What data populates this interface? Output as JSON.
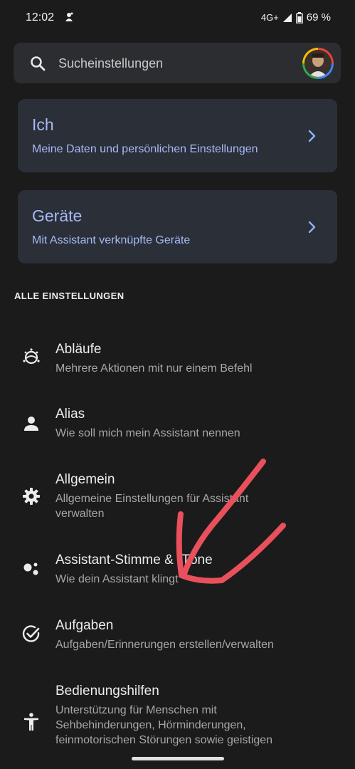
{
  "status_bar": {
    "time": "12:02",
    "network": "4G+",
    "battery": "69 %"
  },
  "search": {
    "placeholder": "Sucheinstellungen"
  },
  "cards": [
    {
      "title": "Ich",
      "subtitle": "Meine Daten und persönlichen Einstellungen"
    },
    {
      "title": "Geräte",
      "subtitle": "Mit Assistant verknüpfte Geräte"
    }
  ],
  "section_header": "ALLE EINSTELLUNGEN",
  "settings": [
    {
      "title": "Abläufe",
      "subtitle": "Mehrere Aktionen mit nur einem Befehl",
      "icon": "routines-icon"
    },
    {
      "title": "Alias",
      "subtitle": "Wie soll mich mein Assistant nennen",
      "icon": "person-icon"
    },
    {
      "title": "Allgemein",
      "subtitle": "Allgemeine Einstellungen für Assistant verwalten",
      "icon": "gear-icon"
    },
    {
      "title": "Assistant-Stimme & -Töne",
      "subtitle": "Wie dein Assistant klingt",
      "icon": "assistant-icon"
    },
    {
      "title": "Aufgaben",
      "subtitle": "Aufgaben/Erinnerungen erstellen/verwalten",
      "icon": "check-circle-icon"
    },
    {
      "title": "Bedienungshilfen",
      "subtitle": "Unterstützung für Menschen mit Sehbehinderungen, Hörminderungen, feinmotorischen Störungen sowie geistigen",
      "icon": "accessibility-icon"
    }
  ],
  "colors": {
    "background": "#1b1b1b",
    "card": "#2a2f38",
    "accent": "#a7b9f5",
    "chevron": "#8ab4f8",
    "annotation": "#e8505b"
  }
}
